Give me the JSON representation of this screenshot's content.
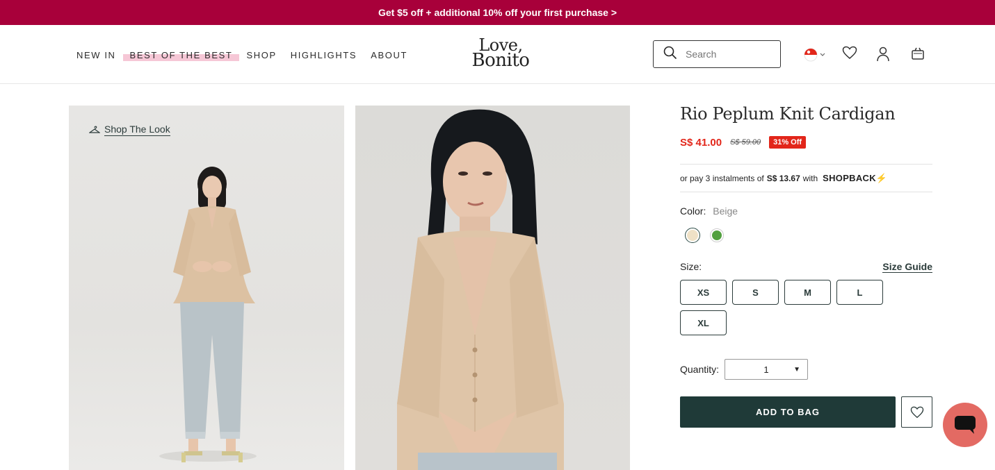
{
  "promo": {
    "text": "Get $5 off + additional 10% off your first purchase >"
  },
  "nav": {
    "items": [
      {
        "label": "NEW IN"
      },
      {
        "label": "BEST OF THE BEST"
      },
      {
        "label": "SHOP"
      },
      {
        "label": "HIGHLIGHTS"
      },
      {
        "label": "ABOUT"
      }
    ]
  },
  "logo": {
    "line1": "Love,",
    "line2": "Bonito"
  },
  "search": {
    "placeholder": "Search"
  },
  "header_icons": [
    "singapore-flag-icon",
    "heart-icon",
    "user-icon",
    "bag-icon"
  ],
  "gallery": {
    "shop_the_look": "Shop The Look"
  },
  "product": {
    "title": "Rio Peplum Knit Cardigan",
    "price": "S$ 41.00",
    "original_price": "S$ 59.00",
    "discount": "31% Off",
    "instalment_prefix": "or pay 3 instalments of",
    "instalment_amount": "S$ 13.67",
    "instalment_with": "with",
    "instalment_provider": "SHOPBACK",
    "color_label": "Color:",
    "color_value": "Beige",
    "colors": [
      "#efe1c6",
      "#52a03f"
    ],
    "size_label": "Size:",
    "size_guide": "Size Guide",
    "sizes": [
      "XS",
      "S",
      "M",
      "L",
      "XL"
    ],
    "quantity_label": "Quantity:",
    "quantity_value": "1",
    "add_to_bag": "ADD TO BAG"
  },
  "colors": {
    "promo_bg": "#a8003a",
    "accent_dark": "#1f3a38",
    "sale_red": "#e2261a",
    "chat_bg": "#e36a63"
  }
}
